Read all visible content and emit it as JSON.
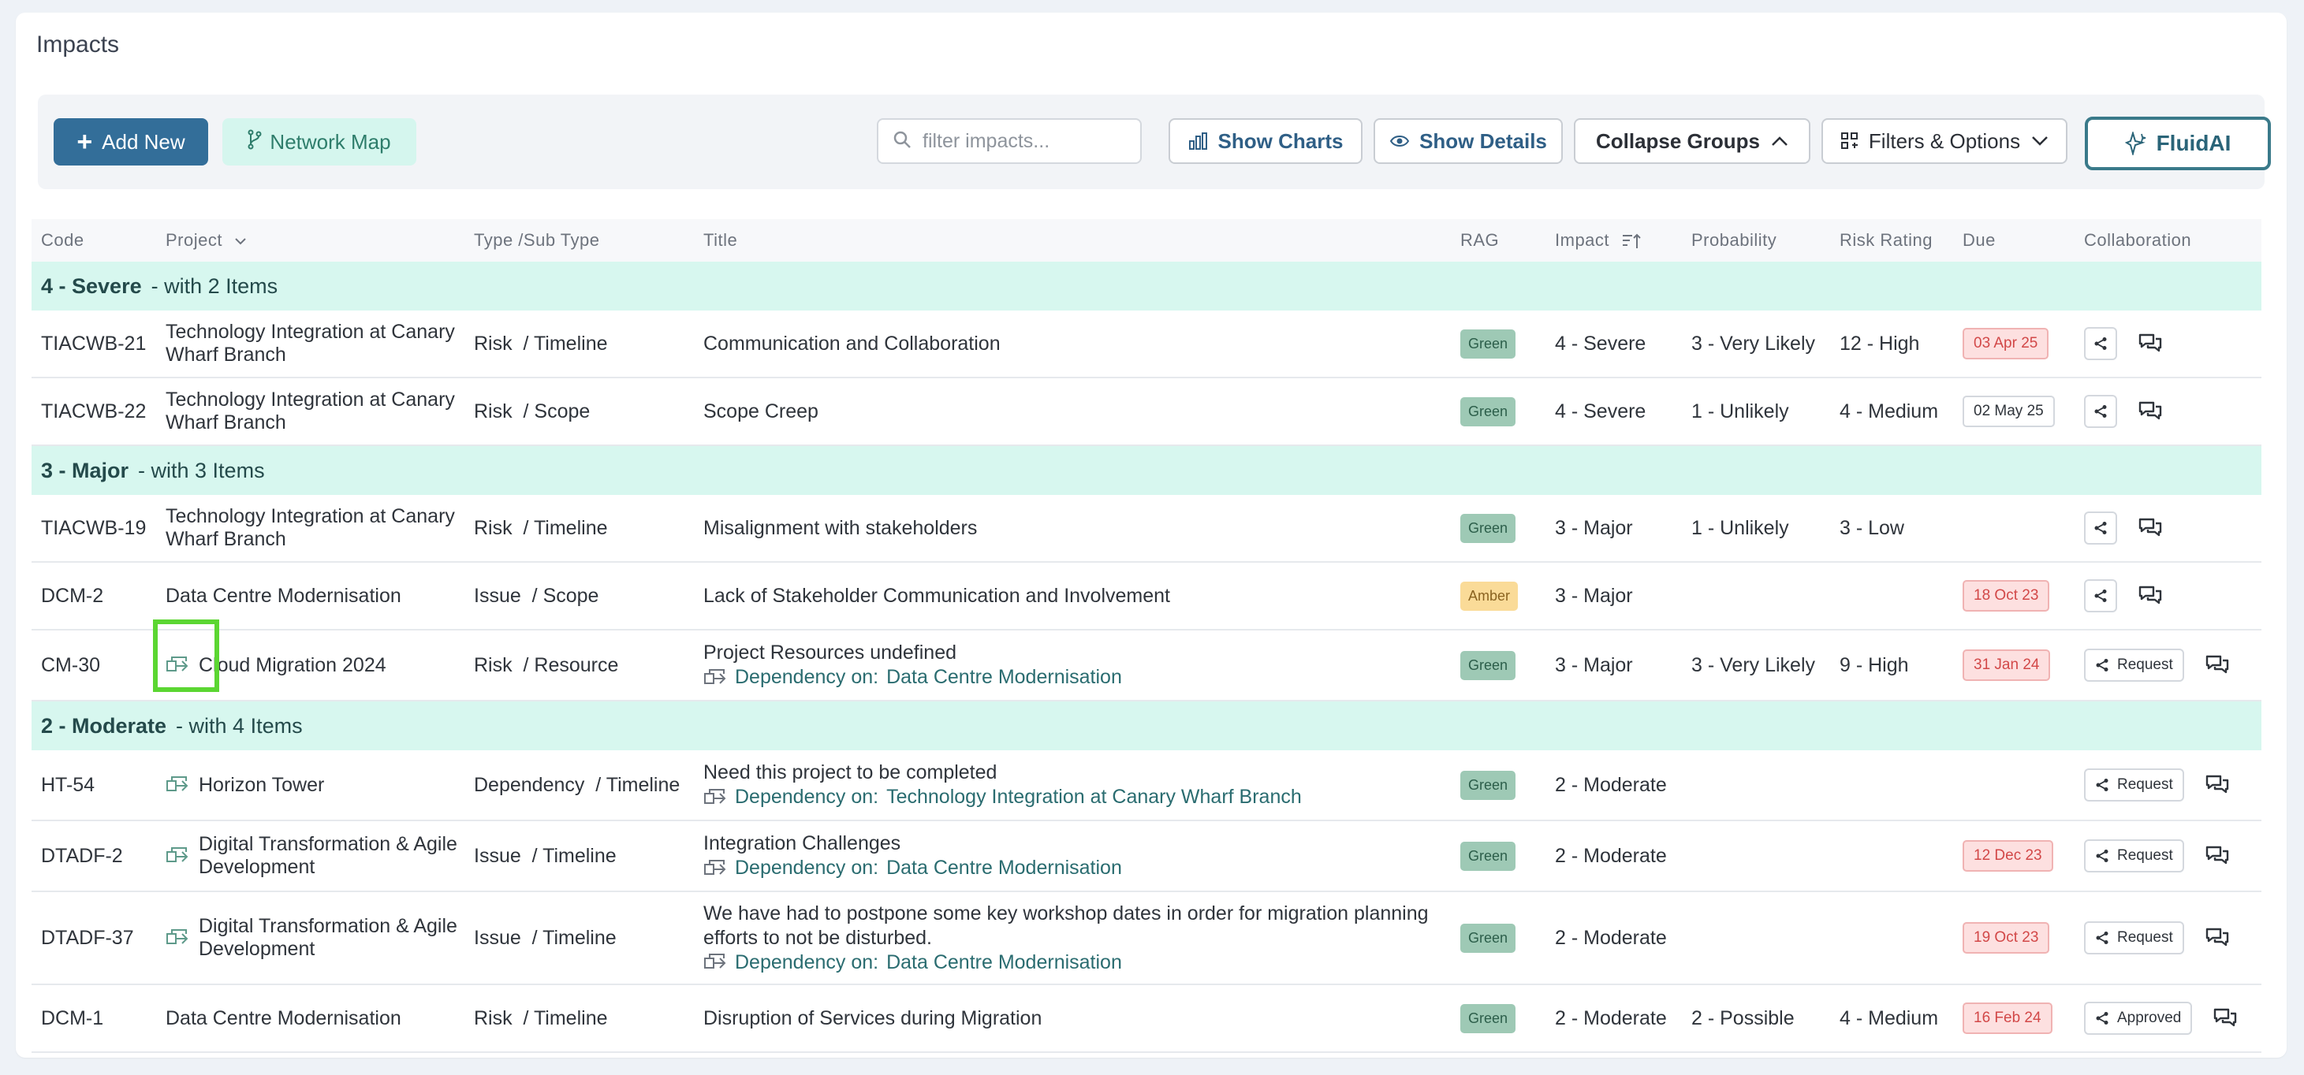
{
  "page": {
    "title": "Impacts"
  },
  "toolbar": {
    "add_new": "Add New",
    "network_map": "Network Map",
    "search_placeholder": "filter impacts...",
    "show_charts": "Show Charts",
    "show_details": "Show Details",
    "collapse_groups": "Collapse Groups",
    "filters_options": "Filters & Options",
    "fluid_ai": "FluidAI"
  },
  "table": {
    "headers": {
      "code": "Code",
      "project": "Project",
      "type": "Type /Sub Type",
      "title": "Title",
      "rag": "RAG",
      "impact": "Impact",
      "probability": "Probability",
      "risk_rating": "Risk Rating",
      "due": "Due",
      "collaboration": "Collaboration"
    },
    "groups": [
      {
        "label": "4 - Severe",
        "suffix": "- with 2 Items",
        "rows": [
          {
            "code": "TIACWB-21",
            "project": "Technology Integration at Canary Wharf Branch",
            "dep_icon": false,
            "type": "Risk",
            "subtype": "/ Timeline",
            "title": "Communication and Collaboration",
            "dep_label": "",
            "dep_target": "",
            "rag": "Green",
            "impact": "4 - Severe",
            "probability": "3 - Very Likely",
            "risk_rating": "12 - High",
            "due": "03 Apr 25",
            "due_style": "red",
            "share_label": ""
          },
          {
            "code": "TIACWB-22",
            "project": "Technology Integration at Canary Wharf Branch",
            "dep_icon": false,
            "type": "Risk",
            "subtype": "/ Scope",
            "title": "Scope Creep",
            "dep_label": "",
            "dep_target": "",
            "rag": "Green",
            "impact": "4 - Severe",
            "probability": "1 - Unlikely",
            "risk_rating": "4 - Medium",
            "due": "02 May 25",
            "due_style": "plain",
            "share_label": ""
          }
        ]
      },
      {
        "label": "3 - Major",
        "suffix": "- with 3 Items",
        "rows": [
          {
            "code": "TIACWB-19",
            "project": "Technology Integration at Canary Wharf Branch",
            "dep_icon": false,
            "type": "Risk",
            "subtype": "/ Timeline",
            "title": "Misalignment with stakeholders",
            "dep_label": "",
            "dep_target": "",
            "rag": "Green",
            "impact": "3 - Major",
            "probability": "1 - Unlikely",
            "risk_rating": "3 - Low",
            "due": "",
            "due_style": "",
            "share_label": ""
          },
          {
            "code": "DCM-2",
            "project": "Data Centre Modernisation",
            "dep_icon": false,
            "type": "Issue",
            "subtype": "/ Scope",
            "title": "Lack of Stakeholder Communication and Involvement",
            "dep_label": "",
            "dep_target": "",
            "rag": "Amber",
            "impact": "3 - Major",
            "probability": "",
            "risk_rating": "",
            "due": "18 Oct 23",
            "due_style": "red",
            "share_label": ""
          },
          {
            "code": "CM-30",
            "project": "Cloud Migration 2024",
            "dep_icon": true,
            "type": "Risk",
            "subtype": "/ Resource",
            "title": "Project Resources undefined",
            "dep_label": "Dependency on:",
            "dep_target": "Data Centre Modernisation",
            "rag": "Green",
            "impact": "3 - Major",
            "probability": "3 - Very Likely",
            "risk_rating": "9 - High",
            "due": "31 Jan 24",
            "due_style": "red",
            "share_label": "Request"
          }
        ]
      },
      {
        "label": "2 - Moderate",
        "suffix": "- with 4 Items",
        "rows": [
          {
            "code": "HT-54",
            "project": "Horizon Tower",
            "dep_icon": true,
            "type": "Dependency",
            "subtype": "/ Timeline",
            "title": "Need this project to be completed",
            "dep_label": "Dependency on:",
            "dep_target": "Technology Integration at Canary Wharf Branch",
            "rag": "Green",
            "impact": "2 - Moderate",
            "probability": "",
            "risk_rating": "",
            "due": "",
            "due_style": "",
            "share_label": "Request"
          },
          {
            "code": "DTADF-2",
            "project": "Digital Transformation & Agile Development",
            "dep_icon": true,
            "type": "Issue",
            "subtype": "/ Timeline",
            "title": "Integration Challenges",
            "dep_label": "Dependency on:",
            "dep_target": "Data Centre Modernisation",
            "rag": "Green",
            "impact": "2 - Moderate",
            "probability": "",
            "risk_rating": "",
            "due": "12 Dec 23",
            "due_style": "red",
            "share_label": "Request"
          },
          {
            "code": "DTADF-37",
            "project": "Digital Transformation & Agile Development",
            "dep_icon": true,
            "type": "Issue",
            "subtype": "/ Timeline",
            "title": "We have had to postpone some key workshop dates in order for migration planning efforts to not be disturbed.",
            "dep_label": "Dependency on:",
            "dep_target": "Data Centre Modernisation",
            "rag": "Green",
            "impact": "2 - Moderate",
            "probability": "",
            "risk_rating": "",
            "due": "19 Oct 23",
            "due_style": "red",
            "share_label": "Request"
          },
          {
            "code": "DCM-1",
            "project": "Data Centre Modernisation",
            "dep_icon": false,
            "type": "Risk",
            "subtype": "/ Timeline",
            "title": "Disruption of Services during Migration",
            "dep_label": "",
            "dep_target": "",
            "rag": "Green",
            "impact": "2 - Moderate",
            "probability": "2 - Possible",
            "risk_rating": "4 - Medium",
            "due": "16 Feb 24",
            "due_style": "red",
            "share_label": "Approved"
          }
        ]
      }
    ]
  },
  "colors": {
    "accent": "#336e99",
    "group_bg": "#d7f7ef",
    "rag_green": "#9ec9b5",
    "rag_amber": "#fadb98",
    "due_red": "#d24848",
    "highlight": "#5bd632"
  },
  "icons": {
    "project_dependency": "dependency-link-icon",
    "share": "share-icon",
    "chat": "chat-icon",
    "search": "search-icon",
    "charts": "bar-chart-icon",
    "details": "eye-icon",
    "filters": "grid-filter-icon",
    "ai": "sparkle-icon"
  }
}
